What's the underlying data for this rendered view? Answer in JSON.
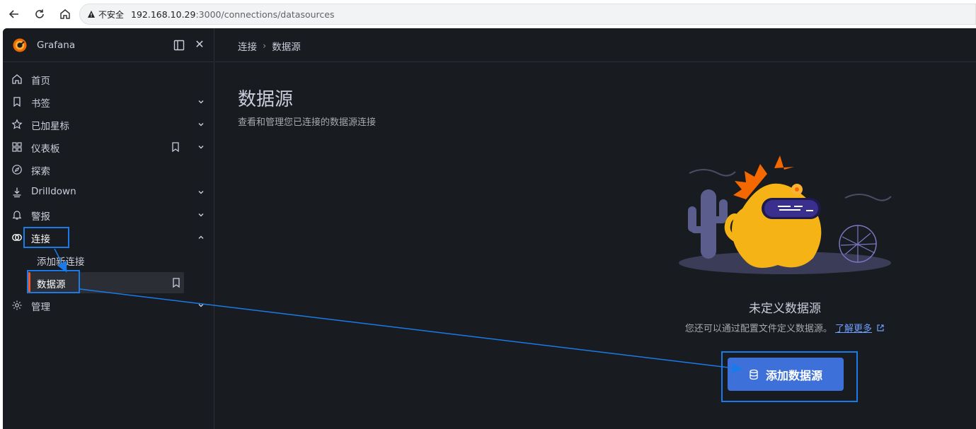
{
  "browser": {
    "security_label": "不安全",
    "url_host": "192.168.10.29",
    "url_path": ":3000/connections/datasources"
  },
  "sidebar": {
    "brand": "Grafana",
    "items": [
      {
        "label": "首页",
        "icon": "home-icon"
      },
      {
        "label": "书签",
        "icon": "bookmark-icon"
      },
      {
        "label": "已加星标",
        "icon": "star-icon"
      },
      {
        "label": "仪表板",
        "icon": "apps-icon"
      },
      {
        "label": "探索",
        "icon": "compass-icon"
      },
      {
        "label": "Drilldown",
        "icon": "drilldown-icon"
      },
      {
        "label": "警报",
        "icon": "bell-icon"
      },
      {
        "label": "连接",
        "icon": "connection-icon"
      },
      {
        "label": "管理",
        "icon": "cog-icon"
      }
    ],
    "sub_items": [
      {
        "label": "添加新连接"
      },
      {
        "label": "数据源"
      }
    ]
  },
  "breadcrumb": {
    "parent": "连接",
    "current": "数据源"
  },
  "page": {
    "title": "数据源",
    "subtitle": "查看和管理您已连接的数据源连接"
  },
  "empty_state": {
    "title": "未定义数据源",
    "description": "您还可以通过配置文件定义数据源。",
    "learn_more": "了解更多",
    "add_button": "添加数据源"
  },
  "colors": {
    "accent": "#3d71d9",
    "active_bar": "#f05a28",
    "annotation": "#1a7be8"
  }
}
